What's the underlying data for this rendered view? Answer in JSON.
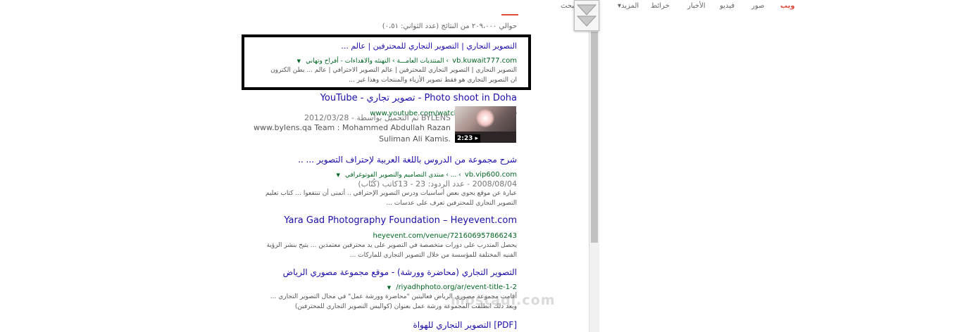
{
  "nav": {
    "tabs": [
      "ويب",
      "صور",
      "فيديو",
      "الأخبار",
      "خرائط",
      "المزيد",
      "أدوات البحث"
    ],
    "active_tab": "ويب",
    "more_caret": "▾"
  },
  "stats": "حوالي ٢٠٩،٠٠٠ من النتائج (عدد الثواني: ٠،٥١)",
  "results": [
    {
      "title": "التصوير التجاري | التصوير التجاري للمحترفين | عالم ...",
      "url": "vb.kuwait777.com",
      "crumbs": "› المنتديات العامـــة › التهنئه والاهداءات - أفراح وتهاني",
      "snippet": [
        "التصوير التجاري | التصوير التجاري للمحترفين | عالم التصوير الاحترافي | عالم ... بطن الكترون",
        "ان التصوير التجاري هو فقط تصوير الأزياء والمنتجات وهذا غير ..."
      ]
    },
    {
      "title": "Photo shoot in Doha - تصوير تجاري - YouTube",
      "url": "www.youtube.com/watch?v=KuLz_pdFoIQ",
      "meta": "2012/03/28 - تم التحميل بواسطة BYLENS",
      "snippet": [
        "www.bylens.qa Team : Mohammed Abdullah Razan",
        "Suliman Ali Kamis."
      ],
      "duration": "2:23 ▸"
    },
    {
      "title": "شرح مجموعة من الدروس باللغة العربية لإحتراف التصوير ... ..",
      "url": "vb.vip600.com",
      "crumbs": "› ... › منتدى التصاميم والتصوير الفوتوغرافي",
      "meta": "2008/08/04 - عدد الردود: 23 - 13كاتب (كُتّاب)",
      "snippet": [
        "عبارة عن موقع يحوي بعض أساسيات ودرس التصوير الإحترافي .. أتمنى أن تنتفعوا ... كتاب تعليم",
        "التصوير التجاري للمحترفين تعرف على عدسات ..."
      ]
    },
    {
      "title": "Yara Gad Photography Foundation – Heyevent.com",
      "url": "heyevent.com/venue/721606957866243",
      "snippet": [
        "يحصل المتدرب على دورات متخصصة في التصوير على يد محترفين معتمدين ... يتيح بنشر الرؤية",
        "الفنيه المختلفة للمؤسسة من خلال التصوير التجاري للماركات ..."
      ]
    },
    {
      "title": "التصوير التجاري (محاضرة وورشة) - موقع مجموعة مصوري الرياض",
      "url": "riyadhphoto.org/ar/event-title-1-2/",
      "snippet": [
        "أقامت مجموعة مصوري الرياض فعاليتين \"محاضرة وورشة عمل\" في مجال التصوير التجاري ...",
        "وبعد ذلك انطلقت المجموعة ورشة عمل بعنوان (كواليس التصوير التجاري للمحترفين)"
      ]
    },
    {
      "title": "[PDF] التصوير التجاري للهواة"
    }
  ],
  "watermark": "mostaql.com"
}
